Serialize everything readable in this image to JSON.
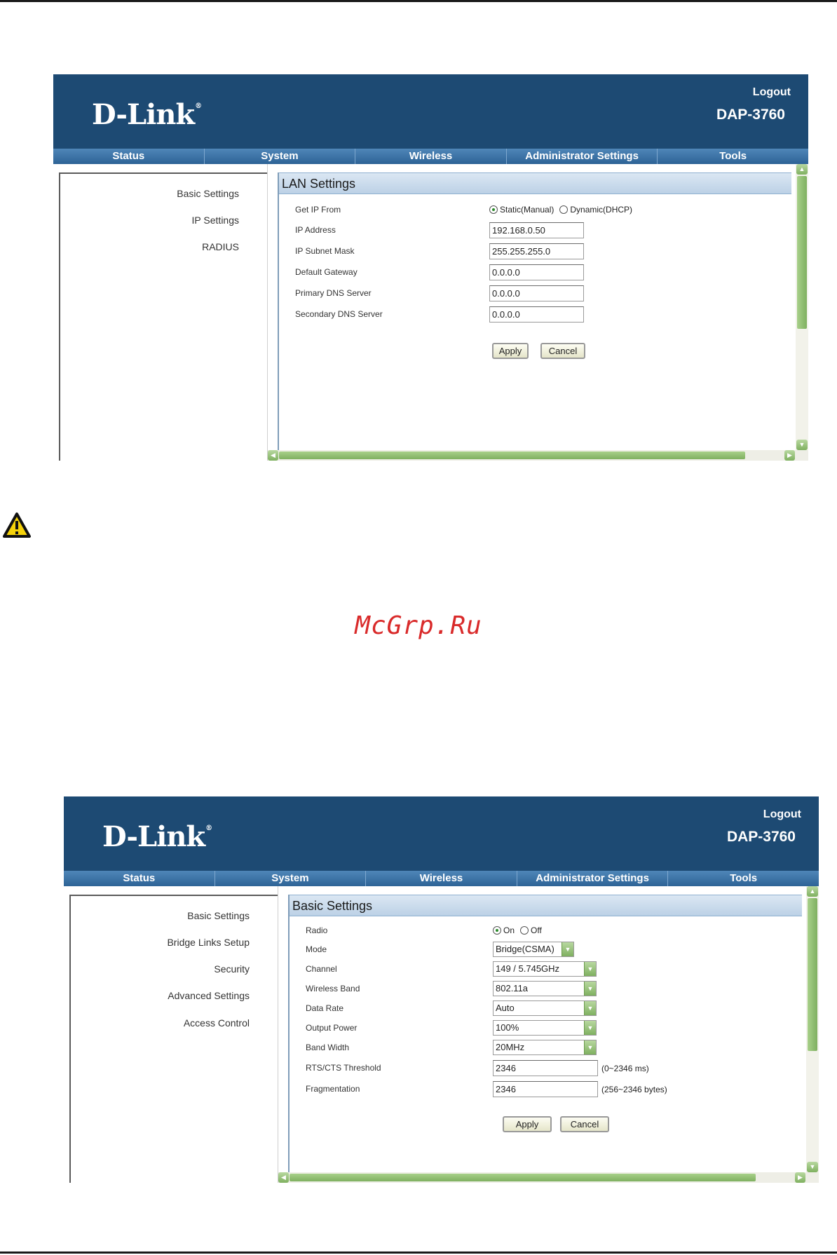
{
  "document": {
    "watermark": "McGrp.Ru"
  },
  "screens": [
    {
      "header": {
        "logo": "D-Link",
        "logout": "Logout",
        "model": "DAP-3760"
      },
      "nav": [
        "Status",
        "System",
        "Wireless",
        "Administrator Settings",
        "Tools"
      ],
      "sidebar": [
        "Basic Settings",
        "IP Settings",
        "RADIUS"
      ],
      "panel": {
        "title": "LAN Settings",
        "get_ip_label": "Get IP From",
        "get_ip_options": [
          "Static(Manual)",
          "Dynamic(DHCP)"
        ],
        "get_ip_selected": "Static(Manual)",
        "fields": [
          {
            "label": "IP Address",
            "value": "192.168.0.50"
          },
          {
            "label": "IP Subnet Mask",
            "value": "255.255.255.0"
          },
          {
            "label": "Default Gateway",
            "value": "0.0.0.0"
          },
          {
            "label": "Primary DNS Server",
            "value": "0.0.0.0"
          },
          {
            "label": "Secondary DNS Server",
            "value": "0.0.0.0"
          }
        ],
        "apply": "Apply",
        "cancel": "Cancel"
      }
    },
    {
      "header": {
        "logo": "D-Link",
        "logout": "Logout",
        "model": "DAP-3760"
      },
      "nav": [
        "Status",
        "System",
        "Wireless",
        "Administrator Settings",
        "Tools"
      ],
      "sidebar": [
        "Basic Settings",
        "Bridge Links Setup",
        "Security",
        "Advanced Settings",
        "Access Control"
      ],
      "panel": {
        "title": "Basic Settings",
        "radio_label": "Radio",
        "radio_options": [
          "On",
          "Off"
        ],
        "radio_selected": "On",
        "selects": [
          {
            "label": "Mode",
            "value": "Bridge(CSMA)"
          },
          {
            "label": "Channel",
            "value": "149 / 5.745GHz"
          },
          {
            "label": "Wireless Band",
            "value": "802.11a"
          },
          {
            "label": "Data Rate",
            "value": "Auto"
          },
          {
            "label": "Output Power",
            "value": "100%"
          },
          {
            "label": "Band Width",
            "value": "20MHz"
          }
        ],
        "inputs": [
          {
            "label": "RTS/CTS Threshold",
            "value": "2346",
            "hint": "(0~2346 ms)"
          },
          {
            "label": "Fragmentation",
            "value": "2346",
            "hint": "(256~2346 bytes)"
          }
        ],
        "apply": "Apply",
        "cancel": "Cancel"
      }
    }
  ]
}
